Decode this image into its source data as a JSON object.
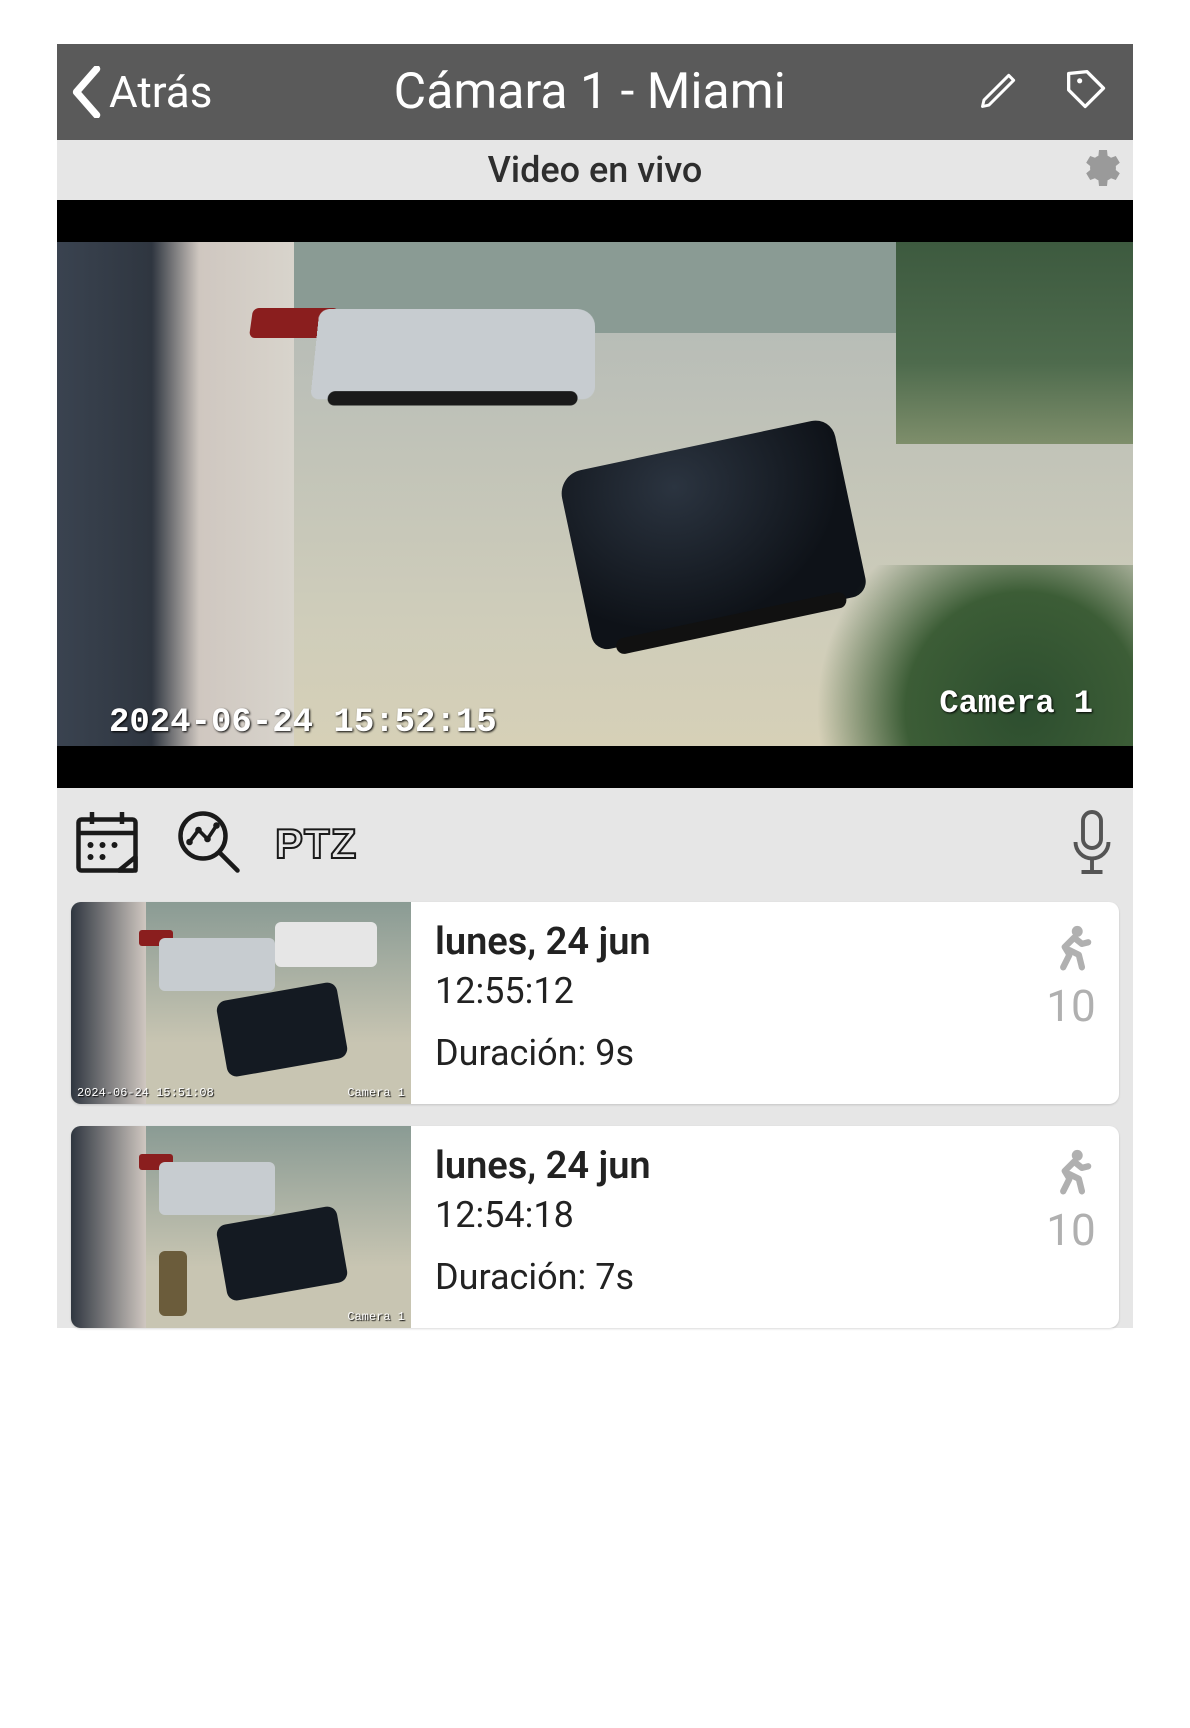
{
  "header": {
    "back_label": "Atrás",
    "title": "Cámara 1 - Miami"
  },
  "subheader": {
    "title": "Video en vivo"
  },
  "video": {
    "camera_overlay": "Camera 1",
    "timestamp_overlay": "2024-06-24 15:52:15"
  },
  "toolbar": {
    "ptz_label": "PTZ"
  },
  "events": [
    {
      "date": "lunes, 24 jun",
      "time": "12:55:12",
      "duration_label": "Duración: 9s",
      "thumb_timestamp": "2024-06-24 15:51:08",
      "thumb_camera": "Camera 1",
      "count": "10",
      "motion_type": "person"
    },
    {
      "date": "lunes, 24 jun",
      "time": "12:54:18",
      "duration_label": "Duración: 7s",
      "thumb_timestamp": "",
      "thumb_camera": "Camera 1",
      "count": "10",
      "motion_type": "person"
    }
  ]
}
